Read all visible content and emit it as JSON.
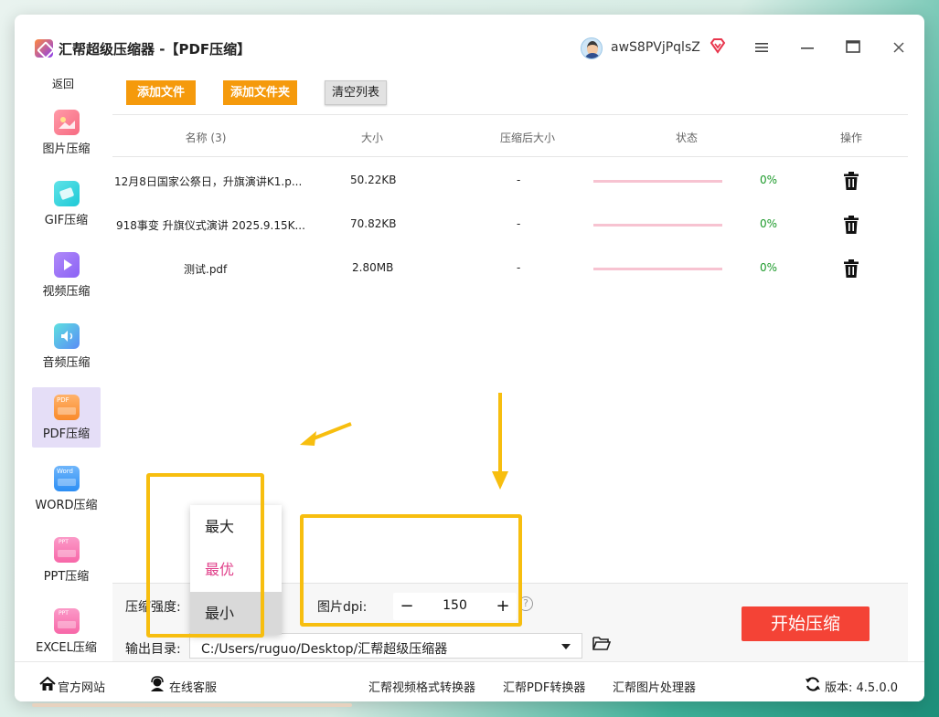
{
  "window": {
    "title": "汇帮超级压缩器  -【PDF压缩】",
    "username": "awS8PVjPqlsZ",
    "controls": {
      "menu": "☰",
      "minimize": "—",
      "maximize": "□",
      "close": "×"
    }
  },
  "sidebar": {
    "back": "返回",
    "items": [
      {
        "label": "图片压缩",
        "icon": "image-compress-icon",
        "color": "#f76b82"
      },
      {
        "label": "GIF压缩",
        "icon": "gif-compress-icon",
        "color": "#1ec9d6"
      },
      {
        "label": "视频压缩",
        "icon": "video-compress-icon",
        "color": "#8b62f5"
      },
      {
        "label": "音频压缩",
        "icon": "audio-compress-icon",
        "color": "#5a8cf5"
      },
      {
        "label": "PDF压缩",
        "icon": "pdf-compress-icon",
        "color": "#f98a2a",
        "active": true,
        "badge": "PDF"
      },
      {
        "label": "WORD压缩",
        "icon": "word-compress-icon",
        "color": "#2c8ef4",
        "badge": "Word"
      },
      {
        "label": "PPT压缩",
        "icon": "ppt-compress-icon",
        "color": "#f767a8",
        "badge": "PPT"
      },
      {
        "label": "EXCEL压缩",
        "icon": "excel-compress-icon",
        "color": "#f767a8",
        "badge": "PPT"
      }
    ]
  },
  "toolbar": {
    "add_file": "添加文件",
    "add_folder": "添加文件夹",
    "clear_list": "清空列表"
  },
  "table": {
    "headers": {
      "name": "名称 (3)",
      "size": "大小",
      "compressed_size": "压缩后大小",
      "status": "状态",
      "action": "操作"
    },
    "rows": [
      {
        "name": "12月8日国家公祭日，升旗演讲K1.p...",
        "size": "50.22KB",
        "compressed": "-",
        "progress": 0,
        "percent": "0%"
      },
      {
        "name": "918事变 升旗仪式演讲 2025.9.15K...",
        "size": "70.82KB",
        "compressed": "-",
        "progress": 0,
        "percent": "0%"
      },
      {
        "name": "测试.pdf",
        "size": "2.80MB",
        "compressed": "-",
        "progress": 0,
        "percent": "0%"
      }
    ]
  },
  "settings": {
    "strength_label": "压缩强度:",
    "dpi_label": "图片dpi:",
    "dpi_value": "150",
    "dpi_minus": "−",
    "dpi_plus": "+",
    "help": "?",
    "output_label": "输出目录:",
    "output_path": "C:/Users/ruguo/Desktop/汇帮超级压缩器",
    "start_button": "开始压缩"
  },
  "strength_dropdown": {
    "options": [
      "最大",
      "最优",
      "最小"
    ],
    "selected": "最小",
    "highlighted": "最优"
  },
  "statusbar": {
    "website": "官方网站",
    "support": "在线客服",
    "video_converter": "汇帮视频格式转换器",
    "pdf_converter": "汇帮PDF转换器",
    "image_processor": "汇帮图片处理器",
    "version": "版本: 4.5.0.0"
  }
}
